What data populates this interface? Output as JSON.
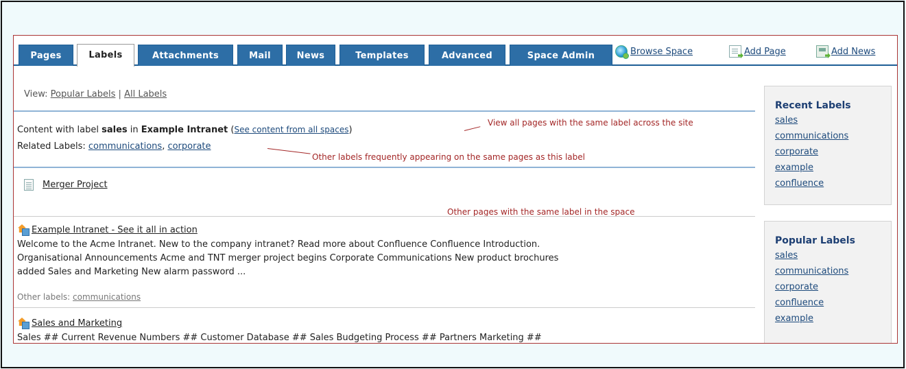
{
  "tabs": [
    {
      "label": "Pages",
      "active": false
    },
    {
      "label": "Labels",
      "active": true
    },
    {
      "label": "Attachments",
      "active": false
    },
    {
      "label": "Mail",
      "active": false
    },
    {
      "label": "News",
      "active": false
    },
    {
      "label": "Templates",
      "active": false
    },
    {
      "label": "Advanced",
      "active": false
    },
    {
      "label": "Space Admin",
      "active": false
    }
  ],
  "toolbar_links": {
    "browse_space": "Browse Space",
    "add_page": "Add Page",
    "add_news": "Add News"
  },
  "view": {
    "prefix": "View:",
    "popular": "Popular Labels",
    "separator": "|",
    "all": "All Labels"
  },
  "content_header": {
    "t1": "Content with label ",
    "label": "sales",
    "t2": " in ",
    "space": "Example Intranet",
    "paren_open": " (",
    "see_all": "See content from all spaces",
    "paren_close": ")"
  },
  "related": {
    "prefix": "Related Labels: ",
    "items": [
      "communications",
      "corporate"
    ],
    "comma": ", "
  },
  "annotations": {
    "view_all": "View all pages with the same label across the site",
    "other_labels": "Other labels frequently appearing on the same pages as this label",
    "other_pages": "Other pages with the same label in the space"
  },
  "results": [
    {
      "title": "Merger Project",
      "icon": "page-icon"
    },
    {
      "title": "Example Intranet - See it all in action",
      "icon": "space-home-icon",
      "excerpt": [
        "Welcome to the Acme Intranet. New to the company intranet? Read more about Confluence Confluence Introduction.",
        "Organisational Announcements Acme and TNT merger project begins Corporate Communications New product brochures",
        "added Sales and Marketing New alarm password ..."
      ],
      "other_labels_prefix": "Other labels: ",
      "other_labels": "communications"
    },
    {
      "title": "Sales and Marketing",
      "icon": "space-home-icon",
      "excerpt": [
        "Sales ## Current Revenue Numbers ## Customer Database ## Sales Budgeting Process ## Partners Marketing ##"
      ]
    }
  ],
  "sidebar": {
    "recent": {
      "title": "Recent Labels",
      "items": [
        "sales",
        "communications",
        "corporate",
        "example",
        "confluence"
      ]
    },
    "popular": {
      "title": "Popular Labels",
      "items": [
        "sales",
        "communications",
        "corporate",
        "confluence",
        "example"
      ]
    }
  },
  "colors": {
    "tab_bg": "#2d6ea6",
    "link": "#1d4a7c",
    "annotation": "#a32626",
    "frame_bg": "#f0fafc"
  }
}
